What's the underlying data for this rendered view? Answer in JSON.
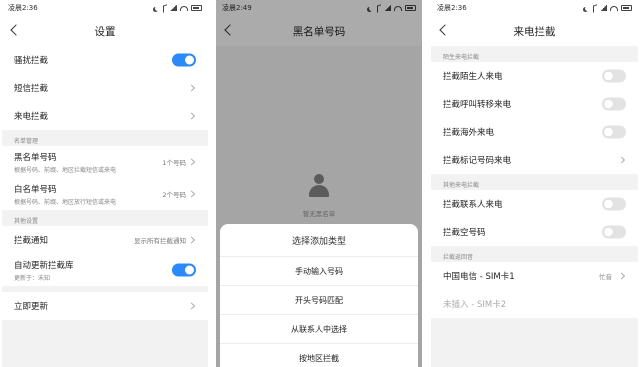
{
  "screen1": {
    "status_time": "凌晨2:36",
    "title": "设置",
    "rows_top": [
      {
        "label": "骚扰拦截"
      },
      {
        "label": "短信拦截"
      },
      {
        "label": "来电拦截"
      }
    ],
    "section_list": "名单管理",
    "blacklist": {
      "label": "黑名单号码",
      "sub": "根据号码、前缀、地区拦截短信或来电",
      "value": "1个号码"
    },
    "whitelist": {
      "label": "白名单号码",
      "sub": "根据号码、前缀、地区放行短信或来电",
      "value": "2个号码"
    },
    "section_other": "其他设置",
    "notify": {
      "label": "拦截通知",
      "value": "显示所有拦截通知"
    },
    "auto_update": {
      "label": "自动更新拦截库",
      "sub": "更新于：未知"
    },
    "update_now": {
      "label": "立即更新"
    }
  },
  "screen2": {
    "status_time": "凌晨2:49",
    "title": "黑名单号码",
    "empty_text": "暂无黑名单",
    "sheet_title": "选择添加类型",
    "options": [
      "手动输入号码",
      "开头号码匹配",
      "从联系人中选择",
      "按地区拦截"
    ]
  },
  "screen3": {
    "status_time": "凌晨2:36",
    "title": "来电拦截",
    "section_stranger": "陌生来电拦截",
    "stranger_rows": [
      {
        "label": "拦截陌生人来电"
      },
      {
        "label": "拦截呼叫转移来电"
      },
      {
        "label": "拦截海外来电"
      },
      {
        "label": "拦截标记号码来电"
      }
    ],
    "section_other": "其他来电拦截",
    "other_rows": [
      {
        "label": "拦截联系人来电"
      },
      {
        "label": "拦截空号码"
      }
    ],
    "section_tone": "拦截返回音",
    "sim1": {
      "label": "中国电信 - SIM卡1",
      "value": "忙音"
    },
    "sim2": {
      "label": "未插入 - SIM卡2"
    }
  },
  "colors": {
    "toggle_on": "#2b8af7",
    "toggle_off": "#e3e3e3",
    "background": "#f2f2f2"
  }
}
